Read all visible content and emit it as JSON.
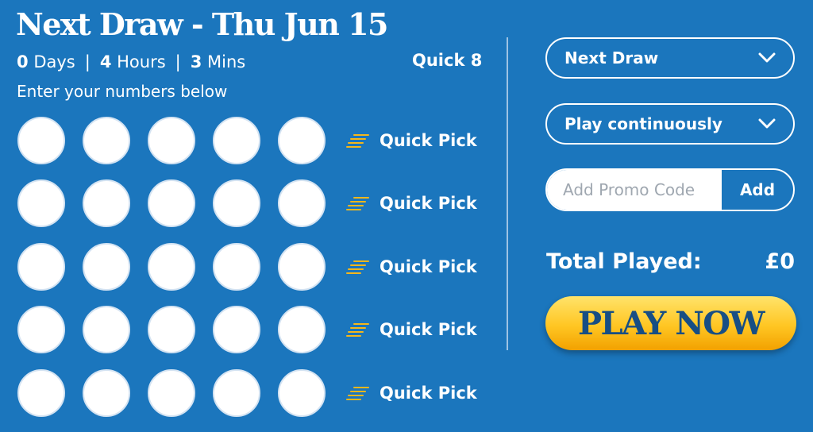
{
  "header": {
    "title": "Next Draw - Thu Jun 15",
    "countdown": {
      "days_value": "0",
      "days_unit": "Days",
      "hours_value": "4",
      "hours_unit": "Hours",
      "mins_value": "3",
      "mins_unit": "Mins",
      "separator": "|"
    },
    "game_name": "Quick 8",
    "instructions": "Enter your numbers below"
  },
  "lines": [
    {
      "quick_pick_label": "Quick Pick",
      "numbers": [
        "",
        "",
        "",
        "",
        ""
      ]
    },
    {
      "quick_pick_label": "Quick Pick",
      "numbers": [
        "",
        "",
        "",
        "",
        ""
      ]
    },
    {
      "quick_pick_label": "Quick Pick",
      "numbers": [
        "",
        "",
        "",
        "",
        ""
      ]
    },
    {
      "quick_pick_label": "Quick Pick",
      "numbers": [
        "",
        "",
        "",
        "",
        ""
      ]
    },
    {
      "quick_pick_label": "Quick Pick",
      "numbers": [
        "",
        "",
        "",
        "",
        ""
      ]
    }
  ],
  "sidebar": {
    "draw_select": {
      "selected": "Next Draw",
      "icon": "chevron-down-icon"
    },
    "duration_select": {
      "selected": "Play continuously",
      "icon": "chevron-down-icon"
    },
    "promo": {
      "placeholder": "Add Promo Code",
      "value": "",
      "button_label": "Add"
    },
    "total": {
      "label": "Total Played:",
      "value": "£0"
    },
    "play_button": {
      "label": "PLAY NOW"
    }
  },
  "icons": {
    "quick_pick": "quick-pick-lines-icon",
    "dropdown": "chevron-down-icon"
  },
  "colors": {
    "background": "#1b76bd",
    "text": "#ffffff",
    "quick_pick_icon": "#f5b71b",
    "play_button": "#ffc623",
    "play_button_text": "#174e84",
    "divider": "#9ec3e4"
  }
}
